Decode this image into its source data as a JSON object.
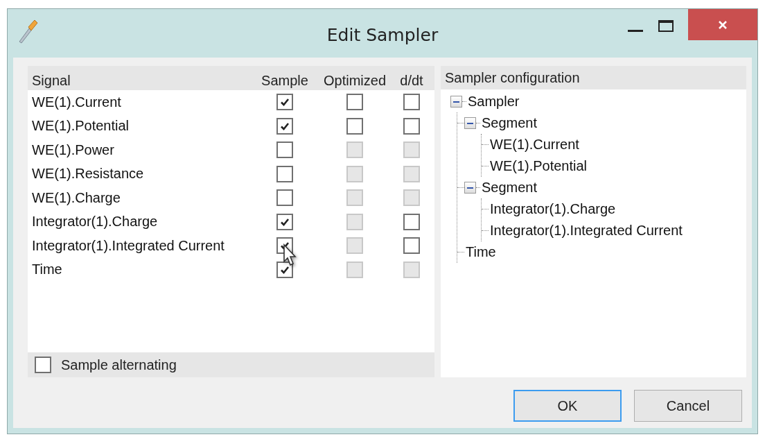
{
  "window": {
    "title": "Edit Sampler"
  },
  "signals": {
    "columns": [
      "Signal",
      "Sample",
      "Optimized",
      "d/dt"
    ],
    "rows": [
      {
        "name": "WE(1).Current",
        "sample": {
          "checked": true,
          "disabled": false
        },
        "optimized": {
          "checked": false,
          "disabled": false
        },
        "ddt": {
          "checked": false,
          "disabled": false
        }
      },
      {
        "name": "WE(1).Potential",
        "sample": {
          "checked": true,
          "disabled": false
        },
        "optimized": {
          "checked": false,
          "disabled": false
        },
        "ddt": {
          "checked": false,
          "disabled": false
        }
      },
      {
        "name": "WE(1).Power",
        "sample": {
          "checked": false,
          "disabled": false
        },
        "optimized": {
          "checked": false,
          "disabled": true
        },
        "ddt": {
          "checked": false,
          "disabled": true
        }
      },
      {
        "name": "WE(1).Resistance",
        "sample": {
          "checked": false,
          "disabled": false
        },
        "optimized": {
          "checked": false,
          "disabled": true
        },
        "ddt": {
          "checked": false,
          "disabled": true
        }
      },
      {
        "name": "WE(1).Charge",
        "sample": {
          "checked": false,
          "disabled": false
        },
        "optimized": {
          "checked": false,
          "disabled": true
        },
        "ddt": {
          "checked": false,
          "disabled": true
        }
      },
      {
        "name": "Integrator(1).Charge",
        "sample": {
          "checked": true,
          "disabled": false
        },
        "optimized": {
          "checked": false,
          "disabled": true
        },
        "ddt": {
          "checked": false,
          "disabled": false
        }
      },
      {
        "name": "Integrator(1).Integrated Current",
        "sample": {
          "checked": true,
          "disabled": false
        },
        "optimized": {
          "checked": false,
          "disabled": true
        },
        "ddt": {
          "checked": false,
          "disabled": false
        }
      },
      {
        "name": "Time",
        "sample": {
          "checked": true,
          "disabled": false
        },
        "optimized": {
          "checked": false,
          "disabled": true
        },
        "ddt": {
          "checked": false,
          "disabled": true
        }
      }
    ],
    "alternating": {
      "label": "Sample alternating",
      "checked": false
    }
  },
  "configuration": {
    "title": "Sampler configuration",
    "tree": [
      {
        "label": "Sampler",
        "expanded": true,
        "children": [
          {
            "label": "Segment",
            "expanded": true,
            "children": [
              {
                "label": "WE(1).Current"
              },
              {
                "label": "WE(1).Potential"
              }
            ]
          },
          {
            "label": "Segment",
            "expanded": true,
            "children": [
              {
                "label": "Integrator(1).Charge"
              },
              {
                "label": "Integrator(1).Integrated Current"
              }
            ]
          },
          {
            "label": "Time"
          }
        ]
      }
    ]
  },
  "buttons": [
    {
      "label": "OK",
      "default": true
    },
    {
      "label": "Cancel",
      "default": false
    }
  ]
}
